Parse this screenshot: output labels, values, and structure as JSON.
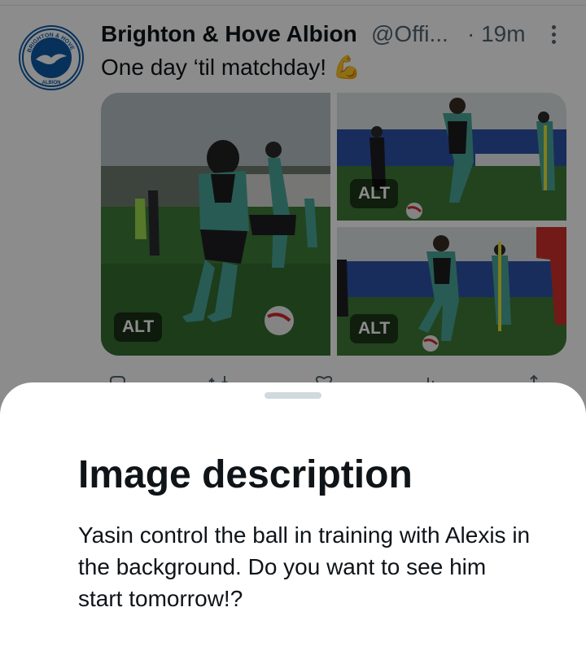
{
  "tweet": {
    "author": "Brighton & Hove Albion",
    "handle": "@Offi...",
    "time": "· 19m",
    "text": "One day ‘til matchday! 💪",
    "media": [
      {
        "alt_badge": "ALT"
      },
      {
        "alt_badge": "ALT"
      },
      {
        "alt_badge": "ALT"
      }
    ],
    "avatar_logo_text": "BRIGHTON & HOVE ALBION",
    "icons": [
      "more-vertical-icon",
      "reply-icon",
      "retweet-icon",
      "like-icon",
      "views-icon",
      "share-icon"
    ]
  },
  "sheet": {
    "title": "Image description",
    "body": "Yasin control the ball in training with Alexis in the background. Do you want to see him start tomorrow!?"
  },
  "colors": {
    "brand_blue": "#0d5aa7",
    "text_primary": "#0f1419",
    "text_secondary": "#536471",
    "overlay": "rgba(0,0,0,0.45)"
  }
}
